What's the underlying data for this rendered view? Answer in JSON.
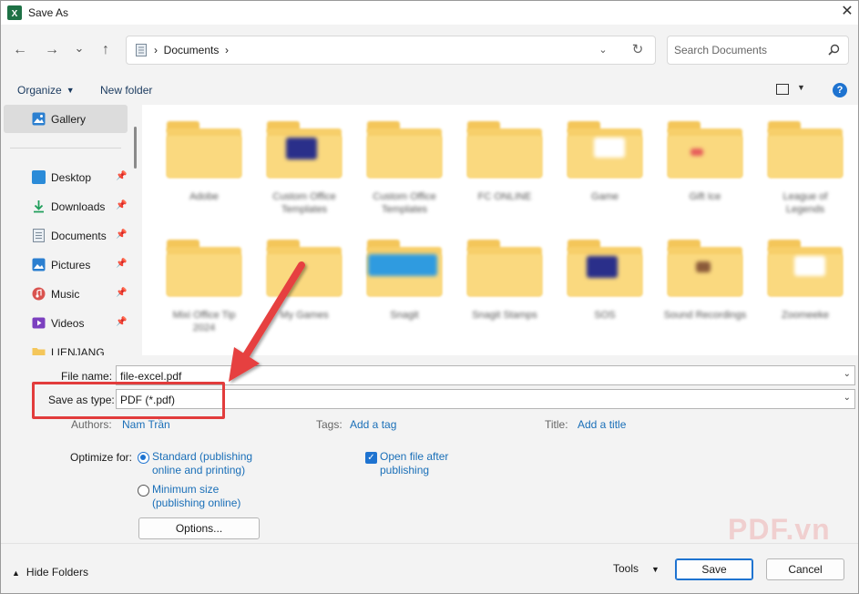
{
  "window": {
    "title": "Save As",
    "app_icon": "excel-icon",
    "close_glyph": "✕"
  },
  "nav": {
    "back_glyph": "←",
    "forward_glyph": "→",
    "recent_glyph": "⌄",
    "up_glyph": "↑",
    "address_path": "›  Documents  ›",
    "address_dropdown_glyph": "⌄",
    "refresh_glyph": "↻",
    "search_placeholder": "Search Documents"
  },
  "toolbar": {
    "organize_label": "Organize",
    "new_folder_label": "New folder",
    "help_glyph": "?"
  },
  "sidebar": {
    "gallery_label": "Gallery",
    "items": [
      {
        "label": "Desktop",
        "icon": "desktop-icon",
        "color": "#2b8bd8"
      },
      {
        "label": "Downloads",
        "icon": "download-icon",
        "color": "#1f9e5a"
      },
      {
        "label": "Documents",
        "icon": "document-icon",
        "color": "#7a8a99"
      },
      {
        "label": "Pictures",
        "icon": "pictures-icon",
        "color": "#2b7fd0"
      },
      {
        "label": "Music",
        "icon": "music-icon",
        "color": "#d9534f"
      },
      {
        "label": "Videos",
        "icon": "videos-icon",
        "color": "#7b3fbf"
      },
      {
        "label": "LIENJANG",
        "icon": "folder-icon",
        "color": "#f4c65a"
      }
    ],
    "pin_glyph": "📌"
  },
  "folders": [
    {
      "name": "Adobe",
      "thumb": ""
    },
    {
      "name": "Custom Office Templates",
      "thumb": "navy"
    },
    {
      "name": "Custom Office Templates",
      "thumb": ""
    },
    {
      "name": "FC ONLINE",
      "thumb": ""
    },
    {
      "name": "Game",
      "thumb": "white"
    },
    {
      "name": "Gift Ice",
      "thumb": "red"
    },
    {
      "name": "League of Legends",
      "thumb": ""
    },
    {
      "name": "Mixi Office Tip 2024",
      "thumb": ""
    },
    {
      "name": "My Games",
      "thumb": ""
    },
    {
      "name": "Snagit",
      "thumb": "blue"
    },
    {
      "name": "Snagit Stamps",
      "thumb": ""
    },
    {
      "name": "SOS",
      "thumb": "navy"
    },
    {
      "name": "Sound Recordings",
      "thumb": "brown"
    },
    {
      "name": "Zoomeeke",
      "thumb": "white"
    }
  ],
  "form": {
    "file_name_label": "File name:",
    "file_name_value": "file-excel.pdf",
    "save_type_label": "Save as type:",
    "save_type_value": "PDF (*.pdf)",
    "dropdown_glyph": "⌄",
    "authors_label": "Authors:",
    "authors_value": "Nam Trần",
    "tags_label": "Tags:",
    "tags_value": "Add a tag",
    "title_label": "Title:",
    "title_value": "Add a title",
    "optimize_label": "Optimize for:",
    "optimize_standard_line1": "Standard (publishing",
    "optimize_standard_line2": "online and printing)",
    "optimize_min_line1": "Minimum size",
    "optimize_min_line2": "(publishing online)",
    "open_after_line1": "Open file after",
    "open_after_line2": "publishing",
    "options_label": "Options..."
  },
  "footer": {
    "hide_folders_label": "Hide Folders",
    "tools_label": "Tools",
    "save_label": "Save",
    "cancel_label": "Cancel"
  },
  "watermark": "PDF.vn",
  "colors": {
    "accent": "#1e73d0",
    "highlight": "#e23c3c",
    "folder": "#f7cf6a"
  }
}
